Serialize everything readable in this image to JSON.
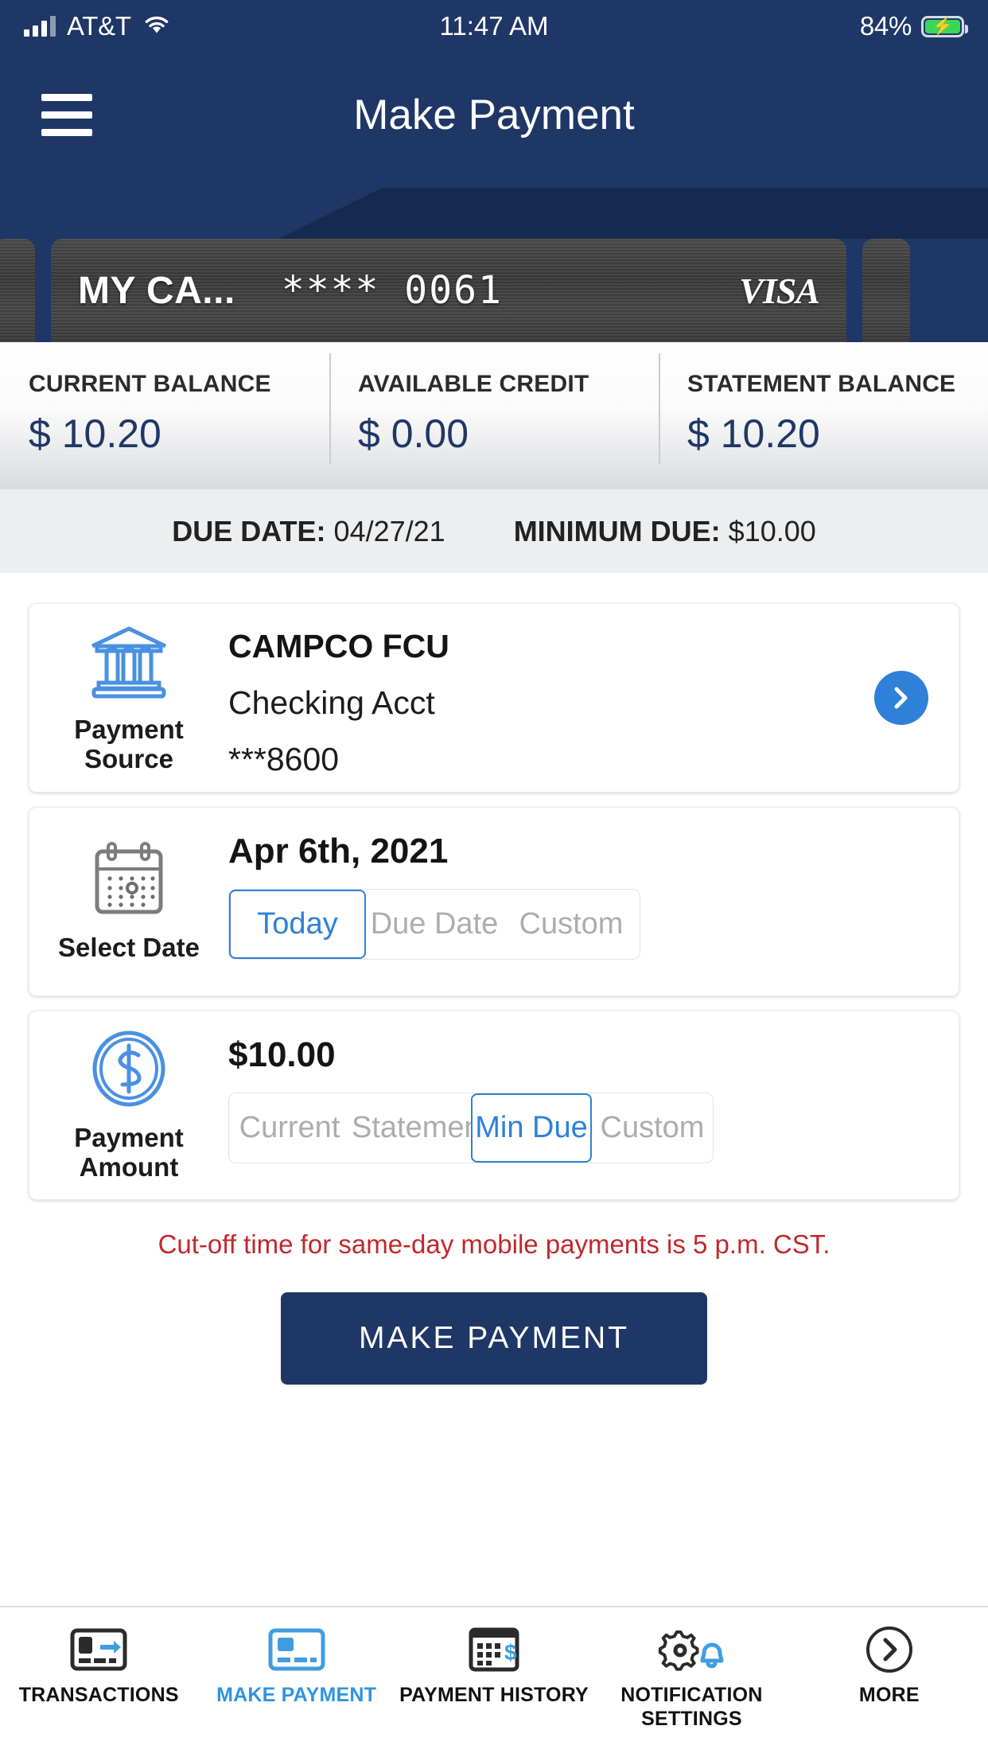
{
  "status_bar": {
    "carrier": "AT&T",
    "time": "11:47 AM",
    "battery_percent": "84%",
    "signal_icon": "signal-bars-icon",
    "wifi_icon": "wifi-icon",
    "battery_icon": "battery-charging-icon"
  },
  "header": {
    "title": "Make Payment",
    "menu_icon": "hamburger-menu-icon",
    "background_color": "#1e3767"
  },
  "card_carousel": {
    "nickname": "MY CA...",
    "masked_number": "**** 0061",
    "brand": "VISA"
  },
  "balances": [
    {
      "label": "CURRENT BALANCE",
      "value": "$ 10.20"
    },
    {
      "label": "AVAILABLE CREDIT",
      "value": "$ 0.00"
    },
    {
      "label": "STATEMENT BALANCE",
      "value": "$ 10.20"
    }
  ],
  "due_row": {
    "due_date_label": "DUE DATE:",
    "due_date_value": "04/27/21",
    "minimum_due_label": "MINIMUM DUE:",
    "minimum_due_value": "$10.00"
  },
  "payment_source": {
    "caption": "Payment Source",
    "icon": "bank-icon",
    "institution": "CAMPCO FCU",
    "account_type": "Checking Acct",
    "account_number": "***8600",
    "chevron_icon": "chevron-right-icon"
  },
  "select_date": {
    "caption": "Select Date",
    "icon": "calendar-icon",
    "value": "Apr 6th, 2021",
    "options": [
      {
        "label": "Today",
        "selected": true
      },
      {
        "label": "Due Date",
        "selected": false
      },
      {
        "label": "Custom",
        "selected": false
      }
    ]
  },
  "payment_amount": {
    "caption": "Payment Amount",
    "icon": "dollar-coin-icon",
    "value": "$10.00",
    "options": [
      {
        "label": "Current",
        "selected": false
      },
      {
        "label": "Statement",
        "selected": false
      },
      {
        "label": "Min Due",
        "selected": true
      },
      {
        "label": "Custom",
        "selected": false
      }
    ]
  },
  "notice": "Cut-off time for same-day mobile payments is 5 p.m. CST.",
  "cta": {
    "label": "MAKE PAYMENT"
  },
  "tab_bar": [
    {
      "label": "TRANSACTIONS",
      "icon": "card-arrow-icon",
      "active": false
    },
    {
      "label": "MAKE PAYMENT",
      "icon": "card-icon",
      "active": true
    },
    {
      "label": "PAYMENT HISTORY",
      "icon": "calendar-dollar-icon",
      "active": false
    },
    {
      "label": "NOTIFICATION SETTINGS",
      "icon": "gear-bell-icon",
      "active": false
    },
    {
      "label": "MORE",
      "icon": "circle-chevron-right-icon",
      "active": false
    }
  ],
  "colors": {
    "navy": "#1e3767",
    "accent_blue": "#2f80d8",
    "tab_blue": "#2f93e0",
    "notice_red": "#c0282d"
  }
}
